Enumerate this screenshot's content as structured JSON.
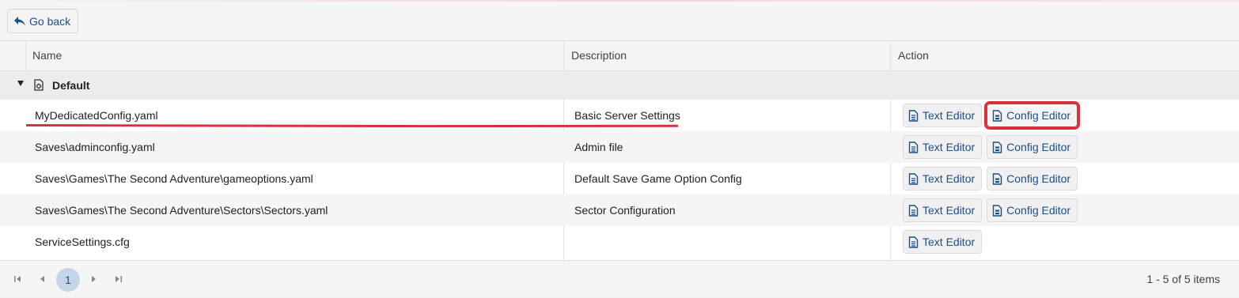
{
  "toolbar": {
    "go_back_label": "Go back"
  },
  "columns": {
    "name": "Name",
    "description": "Description",
    "action": "Action"
  },
  "group": {
    "label": "Default"
  },
  "rows": [
    {
      "name": "MyDedicatedConfig.yaml",
      "description": "Basic Server Settings",
      "text_editor": "Text Editor",
      "config_editor": "Config Editor"
    },
    {
      "name": "Saves\\adminconfig.yaml",
      "description": "Admin file",
      "text_editor": "Text Editor",
      "config_editor": "Config Editor"
    },
    {
      "name": "Saves\\Games\\The Second Adventure\\gameoptions.yaml",
      "description": "Default Save Game Option Config",
      "text_editor": "Text Editor",
      "config_editor": "Config Editor"
    },
    {
      "name": "Saves\\Games\\The Second Adventure\\Sectors\\Sectors.yaml",
      "description": "Sector Configuration",
      "text_editor": "Text Editor",
      "config_editor": "Config Editor"
    },
    {
      "name": "ServiceSettings.cfg",
      "description": "",
      "text_editor": "Text Editor"
    }
  ],
  "pager": {
    "current_page": "1",
    "info": "1 - 5 of 5 items"
  },
  "colors": {
    "accent": "#1a4f8a",
    "highlight": "#d9313b",
    "page_active": "#c4d6e6"
  },
  "icons": [
    "arrow-back-icon",
    "file-settings-icon",
    "text-file-icon",
    "config-file-icon",
    "first-page-icon",
    "prev-page-icon",
    "next-page-icon",
    "last-page-icon"
  ]
}
